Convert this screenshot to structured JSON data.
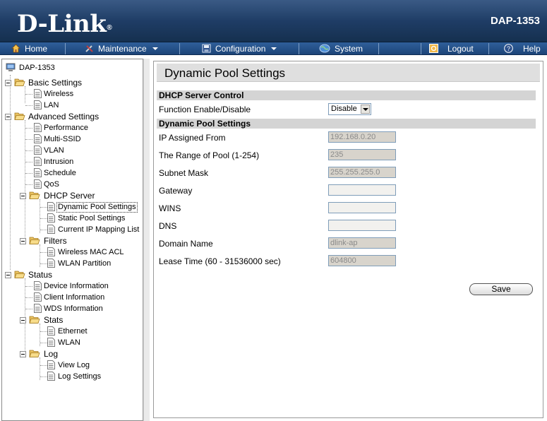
{
  "header": {
    "logo": "D-Link",
    "logo_mark": "®",
    "model": "DAP-1353"
  },
  "menu": {
    "items": [
      {
        "label": "Home",
        "icon": "home-icon"
      },
      {
        "label": "Maintenance",
        "icon": "tools-icon"
      },
      {
        "label": "Configuration",
        "icon": "disk-icon"
      },
      {
        "label": "System",
        "icon": "globe-icon"
      },
      {
        "label": "Logout",
        "icon": "logout-icon"
      },
      {
        "label": "Help",
        "icon": "help-icon"
      }
    ]
  },
  "tree": {
    "root": "DAP-1353",
    "basic": "Basic Settings",
    "wireless": "Wireless",
    "lan": "LAN",
    "advanced": "Advanced Settings",
    "performance": "Performance",
    "multi_ssid": "Multi-SSID",
    "vlan": "VLAN",
    "intrusion": "Intrusion",
    "schedule": "Schedule",
    "qos": "QoS",
    "dhcp_server": "DHCP Server",
    "dynamic_pool": "Dynamic Pool Settings",
    "static_pool": "Static Pool Settings",
    "current_ip": "Current IP Mapping List",
    "filters": "Filters",
    "wireless_mac_acl": "Wireless MAC ACL",
    "wlan_partition": "WLAN Partition",
    "status": "Status",
    "device_info": "Device Information",
    "client_info": "Client Information",
    "wds_info": "WDS Information",
    "stats": "Stats",
    "ethernet": "Ethernet",
    "wlan": "WLAN",
    "log": "Log",
    "view_log": "View Log",
    "log_settings": "Log Settings"
  },
  "main": {
    "title": "Dynamic Pool Settings",
    "section_dhcp": "DHCP Server Control",
    "function_label": "Function Enable/Disable",
    "function_value": "Disable",
    "section_pool": "Dynamic Pool Settings",
    "ip_from_label": "IP Assigned From",
    "ip_from_value": "192.168.0.20",
    "range_label": "The Range of Pool (1-254)",
    "range_value": "235",
    "subnet_label": "Subnet Mask",
    "subnet_value": "255.255.255.0",
    "gateway_label": "Gateway",
    "gateway_value": "",
    "wins_label": "WINS",
    "wins_value": "",
    "dns_label": "DNS",
    "dns_value": "",
    "domain_label": "Domain Name",
    "domain_value": "dlink-ap",
    "lease_label": "Lease Time (60 - 31536000 sec)",
    "lease_value": "604800",
    "save_label": "Save"
  }
}
